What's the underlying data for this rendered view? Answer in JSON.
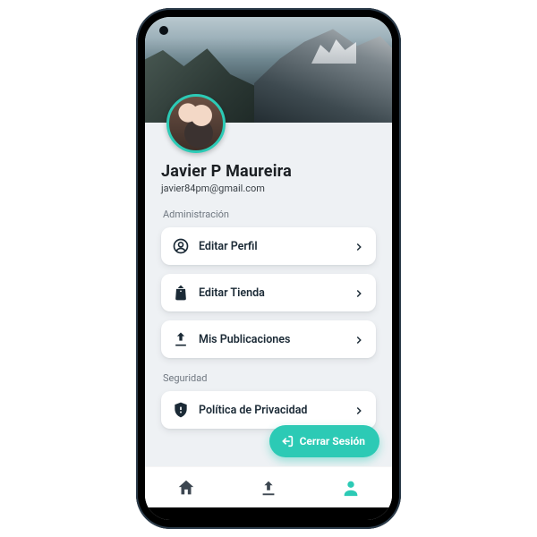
{
  "profile": {
    "name": "Javier P Maureira",
    "email": "javier84pm@gmail.com"
  },
  "sections": {
    "admin": {
      "title": "Administración",
      "items": [
        {
          "icon": "account-circle-icon",
          "label": "Editar Perfil"
        },
        {
          "icon": "shopping-bag-icon",
          "label": "Editar Tienda"
        },
        {
          "icon": "upload-icon",
          "label": "Mis Publicaciones"
        }
      ]
    },
    "security": {
      "title": "Seguridad",
      "items": [
        {
          "icon": "shield-icon",
          "label": "Política de Privacidad"
        }
      ]
    }
  },
  "logout_label": "Cerrar Sesión",
  "nav": {
    "items": [
      {
        "icon": "home-icon",
        "active": false
      },
      {
        "icon": "upload-icon",
        "active": false
      },
      {
        "icon": "profile-icon",
        "active": true
      }
    ]
  },
  "colors": {
    "accent": "#2ccab5"
  }
}
